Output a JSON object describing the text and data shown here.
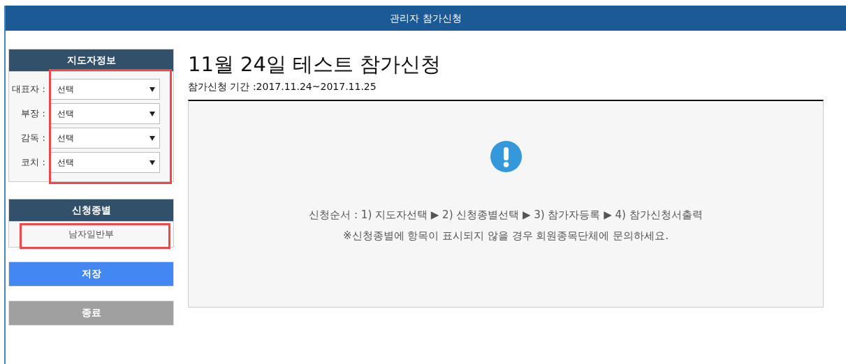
{
  "window": {
    "title": "관리자 참가신청"
  },
  "leader_info": {
    "title": "지도자정보",
    "highlighted": true,
    "fields": [
      {
        "label": "대표자 :",
        "value": "선택"
      },
      {
        "label": "부장 :",
        "value": "선택"
      },
      {
        "label": "감독 :",
        "value": "선택"
      },
      {
        "label": "코치 :",
        "value": "선택"
      }
    ]
  },
  "category": {
    "title": "신청종별",
    "highlighted": true,
    "items": [
      "남자일반부"
    ]
  },
  "buttons": [
    {
      "label": "저장",
      "kind": "primary"
    },
    {
      "label": "종료",
      "kind": "secondary"
    }
  ],
  "heading": "11월 24일 테스트 참가신청",
  "period": "참가신청 기간 :2017.11.24~2017.11.25",
  "notice": {
    "lines": [
      "신청순서 : 1) 지도자선택 ▶ 2) 신청종별선택 ▶ 3) 참가자등록 ▶ 4) 참가신청서출력",
      "※신청종별에 항목이 표시되지 않을 경우 회원종목단체에 문의하세요."
    ]
  }
}
